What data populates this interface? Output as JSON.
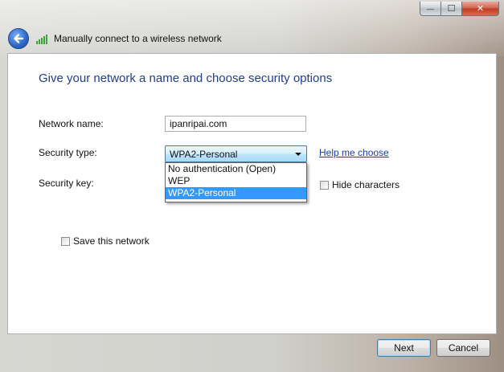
{
  "window": {
    "title": "Manually connect to a wireless network",
    "caption_buttons": {
      "minimize": "—",
      "maximize": "☐",
      "close": "✕"
    }
  },
  "form": {
    "heading": "Give your network a name and choose security options",
    "network_name_label": "Network name:",
    "network_name_value": "ipanripai.com",
    "security_type_label": "Security type:",
    "security_type_selected": "WPA2-Personal",
    "security_type_options": [
      "No authentication (Open)",
      "WEP",
      "WPA2-Personal"
    ],
    "help_link": "Help me choose",
    "security_key_label": "Security key:",
    "hide_characters_label": "Hide characters",
    "save_network_label": "Save this network"
  },
  "buttons": {
    "next": "Next",
    "cancel": "Cancel"
  },
  "colors": {
    "heading": "#1e3f8f",
    "link": "#1a3ea8",
    "selection": "#3399ff"
  },
  "icons": {
    "back": "back-arrow-icon",
    "signal": "wireless-signal-icon"
  }
}
